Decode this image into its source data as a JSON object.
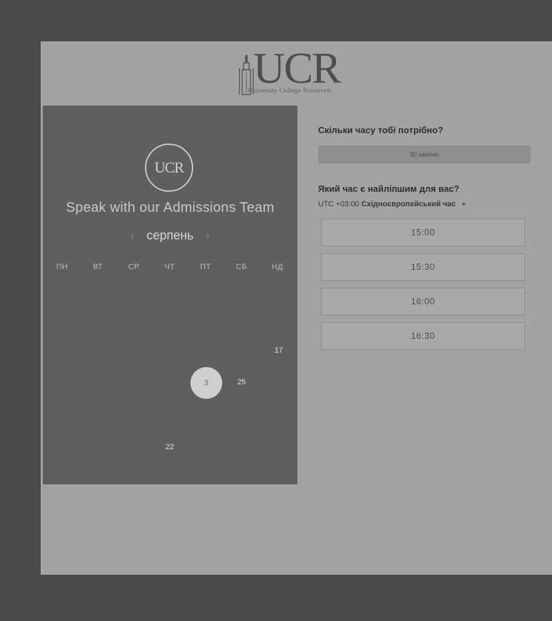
{
  "logo": {
    "text": "UCR",
    "subtitle": "University College Roosevelt",
    "badge_text": "UCR"
  },
  "scheduler": {
    "title": "Speak with our Admissions Team",
    "month": "серпень",
    "prev_icon": "chevron-left-icon",
    "next_icon": "chevron-right-icon",
    "weekdays": [
      "ПН",
      "ВТ",
      "СР",
      "ЧТ",
      "ПТ",
      "СБ",
      "НД"
    ],
    "available_days": [
      "17",
      "3",
      "25",
      "22"
    ],
    "selected_day": "3"
  },
  "booking": {
    "duration_question": "Скільки часу тобі потрібно?",
    "duration_value": "30 хвилин",
    "time_question": "Який час є найліпшим для вас?",
    "timezone_offset": "UTC +03:00",
    "timezone_name": "Східноєвропейський час",
    "slots": [
      "15:00",
      "15:30",
      "16:00",
      "16:30"
    ]
  },
  "colors": {
    "backdrop": "#4a4a4a",
    "panel_left": "#5f5f5f",
    "panel_right": "#a3a3a3"
  }
}
